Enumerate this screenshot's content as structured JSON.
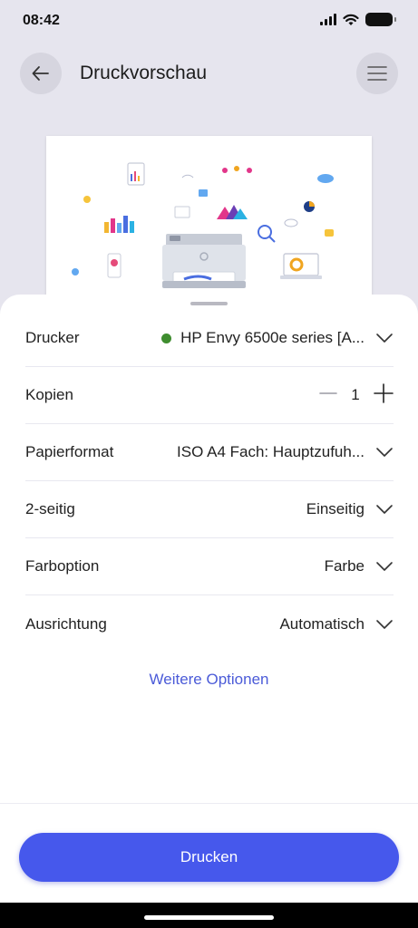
{
  "status_bar": {
    "time": "08:42"
  },
  "header": {
    "title": "Druckvorschau"
  },
  "settings": {
    "printer": {
      "label": "Drucker",
      "value": "HP Envy 6500e series [A..."
    },
    "copies": {
      "label": "Kopien",
      "value": "1"
    },
    "paper": {
      "label": "Papierformat",
      "value": "ISO A4 Fach: Hauptzufuh..."
    },
    "duplex": {
      "label": "2-seitig",
      "value": "Einseitig"
    },
    "color": {
      "label": "Farboption",
      "value": "Farbe"
    },
    "orientation": {
      "label": "Ausrichtung",
      "value": "Automatisch"
    }
  },
  "more_options": "Weitere Optionen",
  "print_button": "Drucken",
  "colors": {
    "accent": "#4658ec",
    "link": "#4b5bd8",
    "status_online": "#3f8d2f"
  },
  "icons": [
    "back-arrow-icon",
    "hamburger-menu-icon",
    "chevron-down-icon",
    "minus-icon",
    "plus-icon",
    "wifi-icon",
    "signal-icon",
    "battery-icon"
  ]
}
